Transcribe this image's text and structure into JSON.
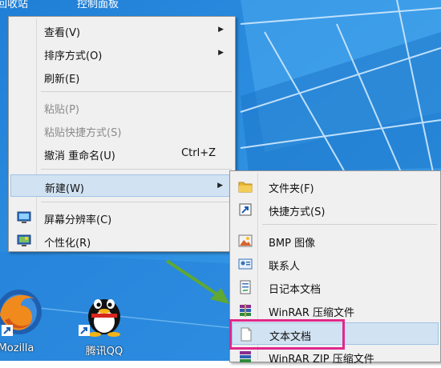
{
  "desktop": {
    "top_labels": [
      "回收站",
      "控制面板"
    ],
    "icons": [
      {
        "label": "Mozilla",
        "icon": "firefox-icon"
      },
      {
        "label": "腾讯QQ",
        "icon": "qq-penguin-icon"
      }
    ]
  },
  "context_menu": {
    "items": [
      {
        "label": "查看(V)",
        "submenu": true
      },
      {
        "label": "排序方式(O)",
        "submenu": true
      },
      {
        "label": "刷新(E)"
      },
      {
        "label": "粘贴(P)",
        "disabled": true
      },
      {
        "label": "粘贴快捷方式(S)",
        "disabled": true
      },
      {
        "label": "撤消 重命名(U)",
        "shortcut": "Ctrl+Z"
      },
      {
        "label": "新建(W)",
        "submenu": true,
        "highlighted": true
      },
      {
        "label": "屏幕分辨率(C)",
        "icon": "display-icon"
      },
      {
        "label": "个性化(R)",
        "icon": "personalize-icon"
      }
    ]
  },
  "new_submenu": {
    "items": [
      {
        "label": "文件夹(F)",
        "icon": "folder-icon"
      },
      {
        "label": "快捷方式(S)",
        "icon": "shortcut-icon"
      },
      {
        "label": "BMP 图像",
        "icon": "bmp-image-icon"
      },
      {
        "label": "联系人",
        "icon": "contact-icon"
      },
      {
        "label": "日记本文档",
        "icon": "journal-icon"
      },
      {
        "label": "WinRAR 压缩文件",
        "icon": "winrar-icon"
      },
      {
        "label": "文本文档",
        "icon": "text-document-icon",
        "highlighted": true
      },
      {
        "label": "WinRAR ZIP 压缩文件",
        "icon": "winrar-zip-icon"
      }
    ]
  },
  "colors": {
    "desktop": "#2a8de0",
    "highlight": "#d1e2f2",
    "annotation_box": "#e0288c",
    "arrow": "#5fa832"
  }
}
